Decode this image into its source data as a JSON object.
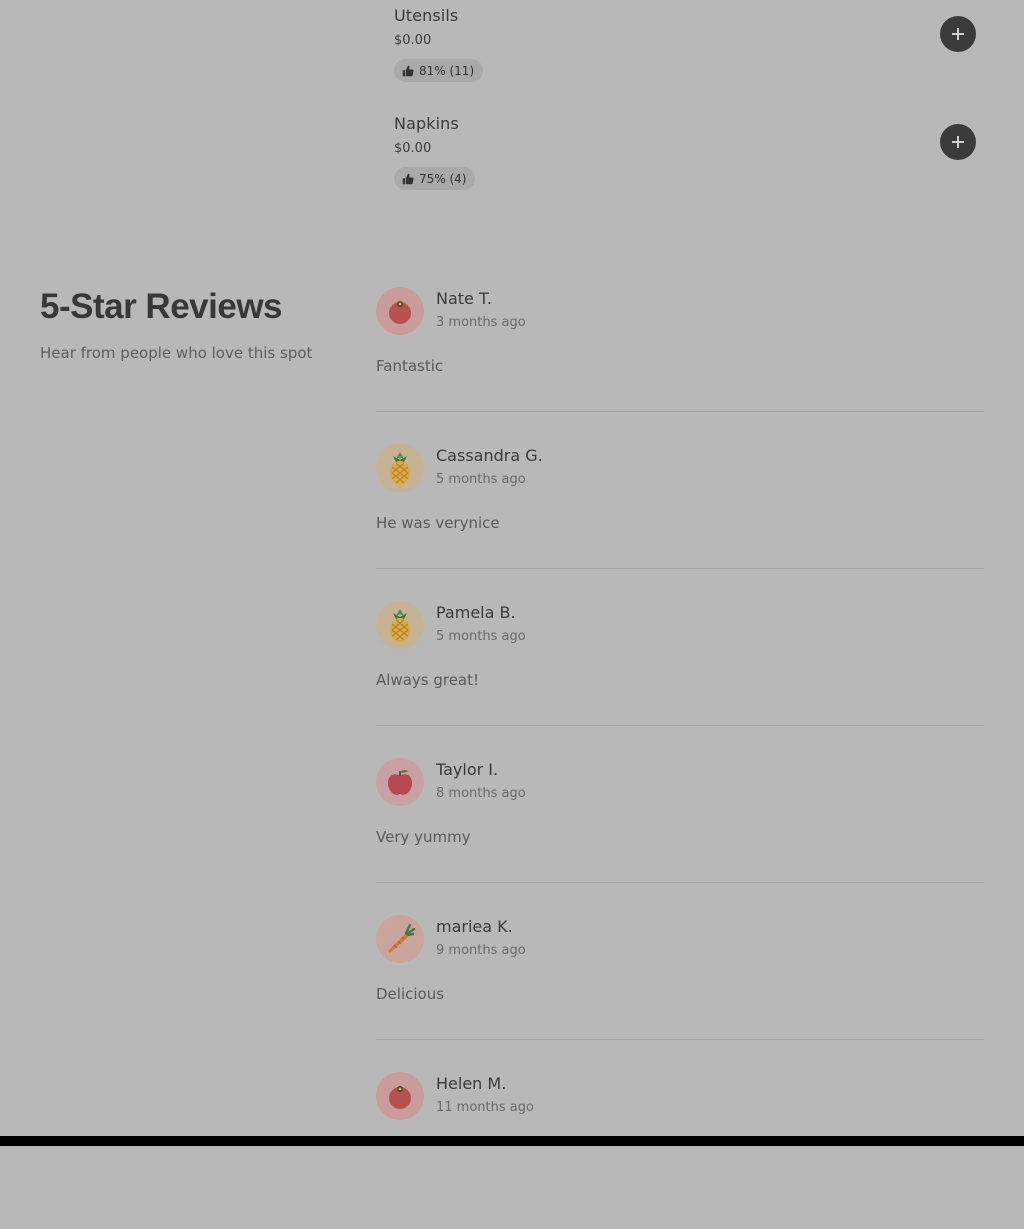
{
  "menu_items": [
    {
      "name": "Utensils",
      "price": "$0.00",
      "rating": "81% (11)"
    },
    {
      "name": "Napkins",
      "price": "$0.00",
      "rating": "75% (4)"
    }
  ],
  "reviews_section": {
    "title": "5-Star Reviews",
    "subtitle": "Hear from people who love this spot"
  },
  "reviews": [
    {
      "name": "Nate T.",
      "date": "3 months ago",
      "text": "Fantastic",
      "avatar": "tomato-icon"
    },
    {
      "name": "Cassandra G.",
      "date": "5 months ago",
      "text": "He was verynice",
      "avatar": "pineapple-icon"
    },
    {
      "name": "Pamela B.",
      "date": "5 months ago",
      "text": "Always great!",
      "avatar": "pineapple-icon"
    },
    {
      "name": "Taylor I.",
      "date": "8 months ago",
      "text": "Very yummy",
      "avatar": "apple-icon"
    },
    {
      "name": "mariea K.",
      "date": "9 months ago",
      "text": "Delicious",
      "avatar": "carrot-icon"
    },
    {
      "name": "Helen M.",
      "date": "11 months ago",
      "text": "",
      "avatar": "tomato-icon"
    }
  ],
  "colors": {
    "overlay_background": "#b8b8b8",
    "add_button": "#3b3b3b",
    "rating_pill": "#a9a9a9"
  }
}
